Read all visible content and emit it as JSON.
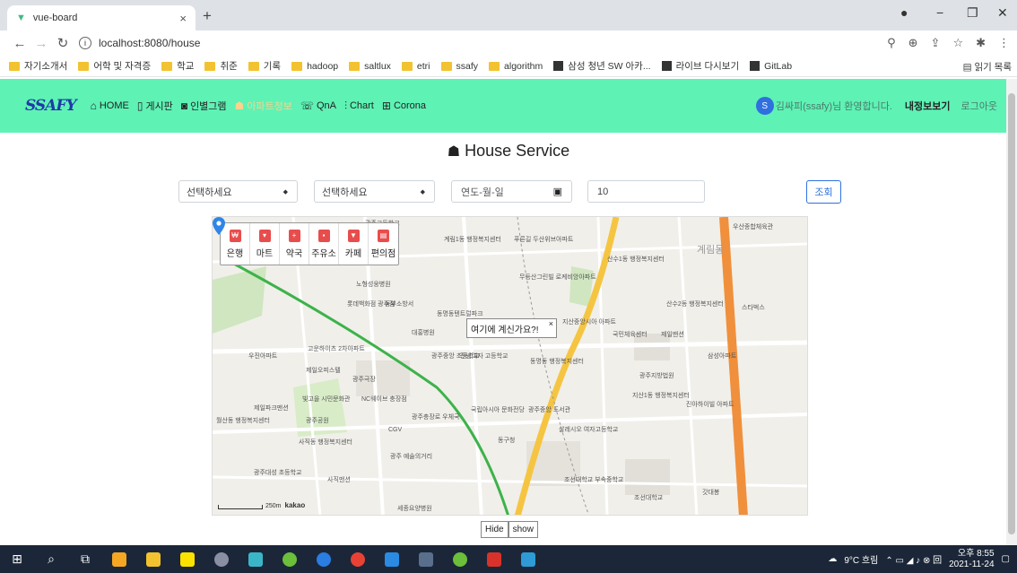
{
  "browser": {
    "tab_title": "vue-board",
    "url": "localhost:8080/house",
    "bookmarks": [
      "자기소개서",
      "어학 및 자격증",
      "학교",
      "취준",
      "기록",
      "hadoop",
      "saltlux",
      "etri",
      "ssafy",
      "algorithm",
      "삼성 청년 SW 아카...",
      "라이브 다시보기",
      "GitLab"
    ],
    "reading_list": "읽기 목록"
  },
  "nav": {
    "logo": "SSAFY",
    "links": [
      "HOME",
      "게시판",
      "인별그램",
      "아파트정보",
      "QnA",
      "Chart",
      "Corona"
    ],
    "avatar_letter": "S",
    "welcome": "김싸피(ssafy)님 환영합니다.",
    "mypage": "내정보보기",
    "logout": "로그아웃"
  },
  "house": {
    "title": "House Service",
    "select1": "선택하세요",
    "select2": "선택하세요",
    "date_placeholder": "연도-월-일",
    "count_value": "10",
    "search_button": "조회"
  },
  "map": {
    "categories": [
      "은행",
      "마트",
      "약국",
      "주유소",
      "카페",
      "편의점"
    ],
    "info_window": "여기에 계신가요?!",
    "scale_label": "250m",
    "brand": "kakao",
    "labels": [
      "계림1동 행정복지센터",
      "푸른길 두산위브아파트",
      "광주고등학교",
      "산수1동 행정복지센터",
      "우산종합체육관",
      "무등산그린빌 로케비앙아파트",
      "노형성웅병원",
      "롯데백화점 광주점",
      "동명동텐트럴파크",
      "동부소방서",
      "계림동",
      "산수2동 행정복지센터",
      "스타벅스",
      "대홍병원",
      "지산중앙시아 아파트",
      "국민체육센터",
      "제일맨션",
      "우진아파트",
      "고운하이츠 2차아파트",
      "제일오피스텔",
      "광주중앙 초등학교",
      "전남여자 고등학교",
      "동명동 행정복지센터",
      "삼성아파트",
      "광주지방법원",
      "지산1동 행정복지센터",
      "진아하이빌 아파트",
      "광주극장",
      "빛고을 시민문화관",
      "NC웨이브 충장점",
      "제일파크맨션",
      "월산동 행정복지센터",
      "광주공원",
      "CGV",
      "광주충장로 우체국",
      "국립아시아 문화전당",
      "광주중앙 도서관",
      "살레시오 여자고등학교",
      "동구청",
      "사직동 행정복지센터",
      "광주대성 초등학교",
      "사직맨션",
      "광주 예술의거리",
      "조선대학교 부속중학교",
      "조선대학교",
      "갓대봉",
      "세종요양병원"
    ],
    "zoom_note": ""
  },
  "buttons": {
    "hide": "Hide",
    "show": "show"
  },
  "taskbar": {
    "weather": "9°C 흐림",
    "time": "오후 8:55",
    "date": "2021-11-24"
  }
}
